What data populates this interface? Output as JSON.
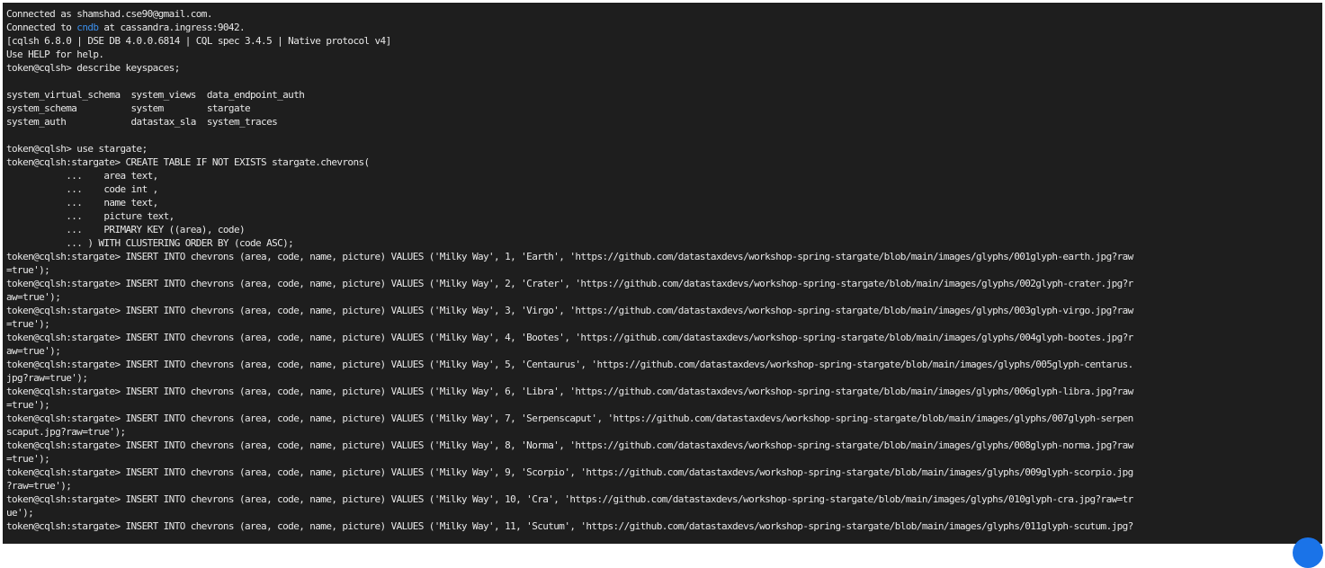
{
  "terminal": {
    "connected_as_prefix": "Connected as shamshad.cse90@gmail.com.",
    "connected_to_prefix": "Connected to ",
    "connected_to_db": "cndb",
    "connected_to_suffix": " at cassandra.ingress:9042.",
    "lines": [
      "[cqlsh 6.8.0 | DSE DB 4.0.0.6814 | CQL spec 3.4.5 | Native protocol v4]",
      "Use HELP for help.",
      "token@cqlsh> describe keyspaces;",
      "",
      "system_virtual_schema  system_views  data_endpoint_auth",
      "system_schema          system        stargate",
      "system_auth            datastax_sla  system_traces",
      "",
      "token@cqlsh> use stargate;",
      "token@cqlsh:stargate> CREATE TABLE IF NOT EXISTS stargate.chevrons(",
      "           ...    area text,",
      "           ...    code int ,",
      "           ...    name text,",
      "           ...    picture text,",
      "           ...    PRIMARY KEY ((area), code)",
      "           ... ) WITH CLUSTERING ORDER BY (code ASC);",
      "token@cqlsh:stargate> INSERT INTO chevrons (area, code, name, picture) VALUES ('Milky Way', 1, 'Earth', 'https://github.com/datastaxdevs/workshop-spring-stargate/blob/main/images/glyphs/001glyph-earth.jpg?raw",
      "=true');",
      "token@cqlsh:stargate> INSERT INTO chevrons (area, code, name, picture) VALUES ('Milky Way', 2, 'Crater', 'https://github.com/datastaxdevs/workshop-spring-stargate/blob/main/images/glyphs/002glyph-crater.jpg?r",
      "aw=true');",
      "token@cqlsh:stargate> INSERT INTO chevrons (area, code, name, picture) VALUES ('Milky Way', 3, 'Virgo', 'https://github.com/datastaxdevs/workshop-spring-stargate/blob/main/images/glyphs/003glyph-virgo.jpg?raw",
      "=true');",
      "token@cqlsh:stargate> INSERT INTO chevrons (area, code, name, picture) VALUES ('Milky Way', 4, 'Bootes', 'https://github.com/datastaxdevs/workshop-spring-stargate/blob/main/images/glyphs/004glyph-bootes.jpg?r",
      "aw=true');",
      "token@cqlsh:stargate> INSERT INTO chevrons (area, code, name, picture) VALUES ('Milky Way', 5, 'Centaurus', 'https://github.com/datastaxdevs/workshop-spring-stargate/blob/main/images/glyphs/005glyph-centarus.",
      "jpg?raw=true');",
      "token@cqlsh:stargate> INSERT INTO chevrons (area, code, name, picture) VALUES ('Milky Way', 6, 'Libra', 'https://github.com/datastaxdevs/workshop-spring-stargate/blob/main/images/glyphs/006glyph-libra.jpg?raw",
      "=true');",
      "token@cqlsh:stargate> INSERT INTO chevrons (area, code, name, picture) VALUES ('Milky Way', 7, 'Serpenscaput', 'https://github.com/datastaxdevs/workshop-spring-stargate/blob/main/images/glyphs/007glyph-serpen",
      "scaput.jpg?raw=true');",
      "token@cqlsh:stargate> INSERT INTO chevrons (area, code, name, picture) VALUES ('Milky Way', 8, 'Norma', 'https://github.com/datastaxdevs/workshop-spring-stargate/blob/main/images/glyphs/008glyph-norma.jpg?raw",
      "=true');",
      "token@cqlsh:stargate> INSERT INTO chevrons (area, code, name, picture) VALUES ('Milky Way', 9, 'Scorpio', 'https://github.com/datastaxdevs/workshop-spring-stargate/blob/main/images/glyphs/009glyph-scorpio.jpg",
      "?raw=true');",
      "token@cqlsh:stargate> INSERT INTO chevrons (area, code, name, picture) VALUES ('Milky Way', 10, 'Cra', 'https://github.com/datastaxdevs/workshop-spring-stargate/blob/main/images/glyphs/010glyph-cra.jpg?raw=tr",
      "ue');",
      "token@cqlsh:stargate> INSERT INTO chevrons (area, code, name, picture) VALUES ('Milky Way', 11, 'Scutum', 'https://github.com/datastaxdevs/workshop-spring-stargate/blob/main/images/glyphs/011glyph-scutum.jpg?"
    ]
  },
  "colors": {
    "background": "#1e1e1e",
    "foreground": "#e8e8e8",
    "highlight": "#3b8eea",
    "fab": "#1a73e8"
  }
}
